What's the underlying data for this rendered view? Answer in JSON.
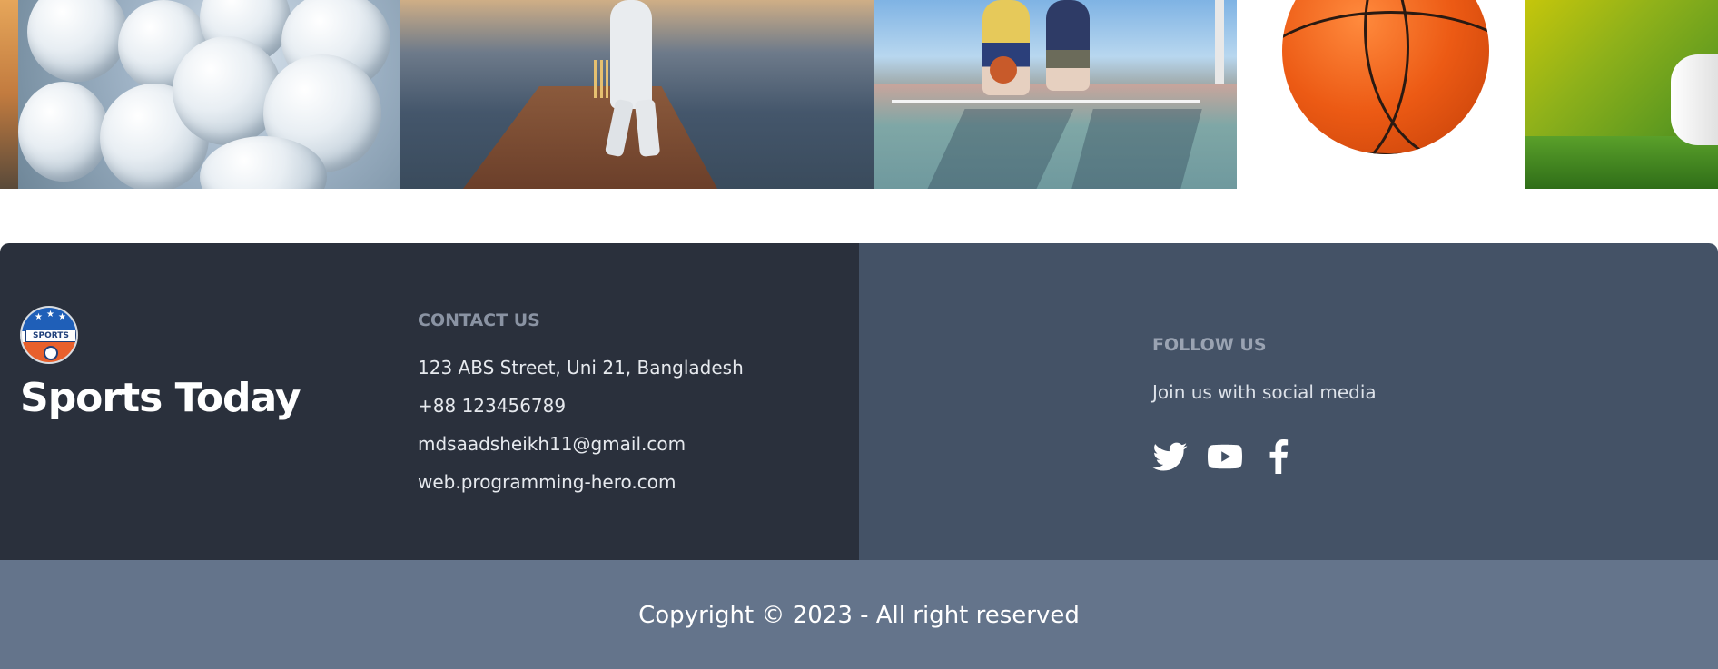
{
  "gallery": {
    "images": [
      {
        "name": "sunset-strip"
      },
      {
        "name": "golf-balls"
      },
      {
        "name": "cricket-batsman"
      },
      {
        "name": "street-basketball"
      },
      {
        "name": "basketball"
      },
      {
        "name": "golf-club-on-grass"
      }
    ]
  },
  "brand": {
    "logo_text": "SPORTS",
    "name": "Sports Today"
  },
  "contact": {
    "heading": "CONTACT US",
    "items": [
      "123 ABS Street, Uni 21, Bangladesh",
      "+88 123456789",
      "mdsaadsheikh11@gmail.com",
      "web.programming-hero.com"
    ]
  },
  "follow": {
    "heading": "FOLLOW US",
    "text": "Join us with social media",
    "icons": [
      "twitter-icon",
      "youtube-icon",
      "facebook-icon"
    ]
  },
  "footer": {
    "copyright": "Copyright © 2023 - All right reserved"
  },
  "colors": {
    "footer_left_bg": "#2a303c",
    "footer_right_bg": "#445266",
    "footer_bottom_bg": "#64748b",
    "heading_muted": "#8a93a3",
    "text_light": "#e6e9ee"
  }
}
